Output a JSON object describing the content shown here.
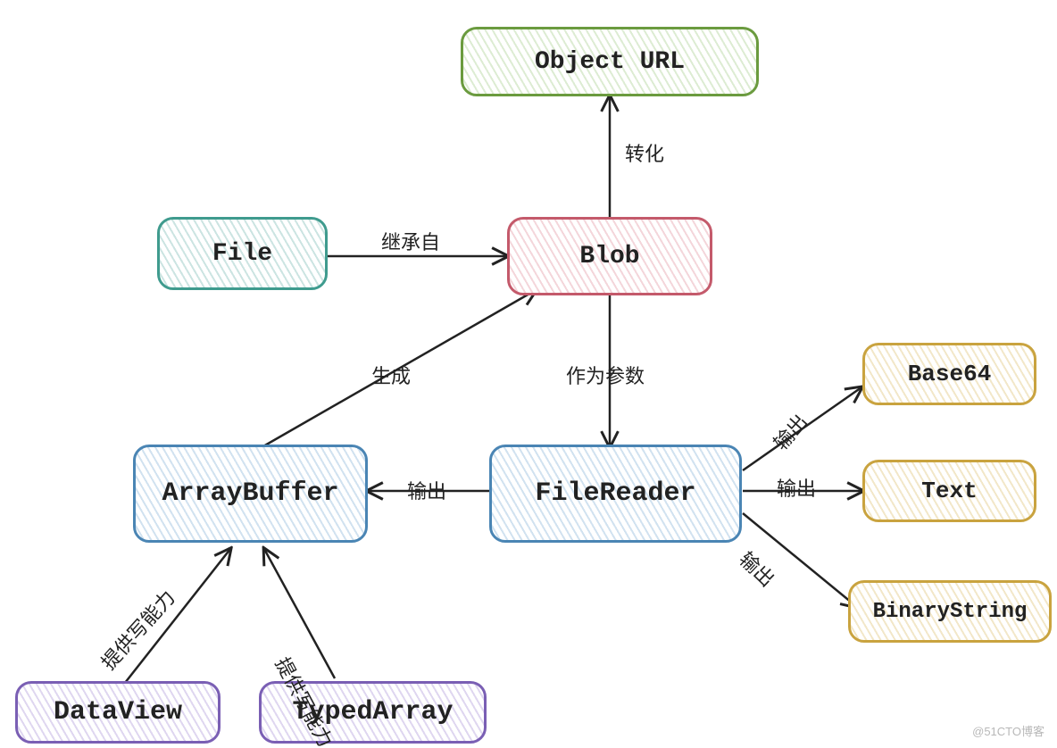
{
  "nodes": {
    "object_url": {
      "label": "Object URL"
    },
    "file": {
      "label": "File"
    },
    "blob": {
      "label": "Blob"
    },
    "arraybuffer": {
      "label": "ArrayBuffer"
    },
    "filereader": {
      "label": "FileReader"
    },
    "base64": {
      "label": "Base64"
    },
    "text": {
      "label": "Text"
    },
    "binarystring": {
      "label": "BinaryString"
    },
    "dataview": {
      "label": "DataView"
    },
    "typedarray": {
      "label": "TypedArray"
    }
  },
  "edges": {
    "blob_to_objecturl": {
      "label": "转化"
    },
    "file_to_blob": {
      "label": "继承自"
    },
    "arraybuffer_to_blob": {
      "label": "生成"
    },
    "blob_to_filereader": {
      "label": "作为参数"
    },
    "filereader_to_arraybuffer": {
      "label": "输出"
    },
    "filereader_to_base64": {
      "label": "输出"
    },
    "filereader_to_text": {
      "label": "输出"
    },
    "filereader_to_binarystring": {
      "label": "输出"
    },
    "dataview_to_arraybuffer": {
      "label": "提供写能力"
    },
    "typedarray_to_arraybuffer": {
      "label": "提供写能力"
    }
  },
  "watermark": "@51CTO博客"
}
